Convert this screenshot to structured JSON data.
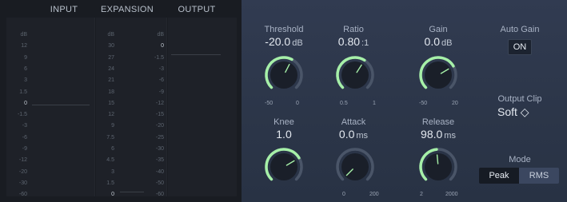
{
  "meters": {
    "headers": [
      "INPUT",
      "EXPANSION",
      "OUTPUT"
    ],
    "input_scale": [
      "dB",
      "12",
      "9",
      "6",
      "3",
      "1.5",
      "0",
      "-1.5",
      "-3",
      "-6",
      "-9",
      "-12",
      "-20",
      "-30",
      "-60"
    ],
    "expansion_scale": [
      "dB",
      "30",
      "27",
      "24",
      "21",
      "18",
      "15",
      "12",
      "9",
      "7.5",
      "6",
      "4.5",
      "3",
      "1.5",
      "0"
    ],
    "output_scale": [
      "dB",
      "0",
      "-1.5",
      "-3",
      "-6",
      "-9",
      "-12",
      "-15",
      "-20",
      "-25",
      "-30",
      "-35",
      "-40",
      "-50",
      "-60"
    ]
  },
  "controls": {
    "threshold": {
      "label": "Threshold",
      "value": "-20.0",
      "unit": "dB",
      "min": "-50",
      "max": "0",
      "level": 0.6
    },
    "ratio": {
      "label": "Ratio",
      "value": "0.80",
      "unit": ":1",
      "min": "0.5",
      "max": "1",
      "level": 0.62
    },
    "gain": {
      "label": "Gain",
      "value": "0.0",
      "unit": "dB",
      "min": "-50",
      "max": "20",
      "level": 0.72
    },
    "knee": {
      "label": "Knee",
      "value": "1.0",
      "level": 0.72
    },
    "attack": {
      "label": "Attack",
      "value": "0.0",
      "unit": "ms",
      "min": "0",
      "max": "200",
      "level": 0.0
    },
    "release": {
      "label": "Release",
      "value": "98.0",
      "unit": "ms",
      "min": "2",
      "max": "2000",
      "level": 0.48
    },
    "auto_gain": {
      "label": "Auto Gain",
      "value": "ON"
    },
    "output_clip": {
      "label": "Output Clip",
      "value": "Soft ◇"
    },
    "mode": {
      "label": "Mode",
      "options": [
        "Peak",
        "RMS"
      ],
      "selected": "Peak"
    }
  },
  "colors": {
    "accent": "#a6f0a8",
    "knob_body": "#1a1f29",
    "arc_bg": "#4a5568"
  }
}
